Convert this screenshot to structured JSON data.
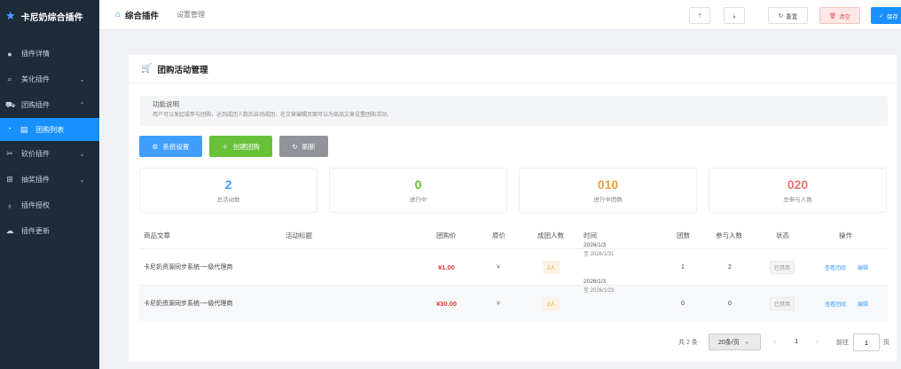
{
  "sidebar": {
    "brand": "卡尼奶综合插件",
    "items": [
      {
        "label": "插件详情",
        "icon": "info-icon"
      },
      {
        "label": "美化插件",
        "icon": "magic-icon",
        "expand": "v"
      },
      {
        "label": "团购插件",
        "icon": "cart-icon",
        "expand": "^"
      },
      {
        "label": "团购列表",
        "icon": "list-icon",
        "active": true
      },
      {
        "label": "砍价插件",
        "icon": "scissors-icon",
        "expand": "v"
      },
      {
        "label": "抽奖插件",
        "icon": "gift-icon",
        "expand": "v"
      },
      {
        "label": "插件授权",
        "icon": "key-icon"
      },
      {
        "label": "插件更新",
        "icon": "cloud-icon"
      }
    ]
  },
  "topbar": {
    "crumb1": "综合插件",
    "crumb2": "设置管理",
    "btn_import": "⇡",
    "btn_export": "⇣",
    "btn_reset": "重置",
    "btn_clear": "清空",
    "btn_save": "保存"
  },
  "card": {
    "title": "团购活动管理",
    "info_title": "功能说明",
    "info_desc": "用户可以发起或参与团购，达到成团人数后自动成团，在文章编辑页面可以为商品文章设置团购活动。",
    "btn_settings": "系统设置",
    "btn_create": "创建团购",
    "btn_refresh": "刷新"
  },
  "stats": [
    {
      "value": "2",
      "label": "总活动数",
      "color": "#409eff"
    },
    {
      "value": "0",
      "label": "进行中",
      "color": "#67c23a"
    },
    {
      "value": "010",
      "label": "进行中团数",
      "color": "#e6a23c"
    },
    {
      "value": "020",
      "label": "总参与人数",
      "color": "#e57373"
    }
  ],
  "table": {
    "headers": [
      "商品文章",
      "活动标题",
      "团购价",
      "原价",
      "成团人数",
      "时间",
      "团数",
      "参与人数",
      "状态",
      "操作"
    ],
    "rows": [
      {
        "article": "卡尼奶资源同步系统-一级代理商",
        "title": "",
        "price": "¥1.00",
        "orig": "¥",
        "size": "2人",
        "date1": "2026/1/3",
        "date2": "至 2026/1/31",
        "groups": "1",
        "people": "2",
        "status": "已禁用",
        "view": "查看团组",
        "edit": "编辑"
      },
      {
        "article": "卡尼奶资源同步系统-一级代理商",
        "title": "",
        "price": "¥30.00",
        "orig": "¥",
        "size": "2人",
        "date1": "2026/1/3",
        "date2": "至 2026/1/23",
        "groups": "0",
        "people": "0",
        "status": "已禁用",
        "view": "查看团组",
        "edit": "编辑"
      }
    ]
  },
  "pagination": {
    "total": "共 2 条",
    "size": "20条/页",
    "page": "1",
    "goto": "前往",
    "input": "1",
    "suffix": "页"
  }
}
